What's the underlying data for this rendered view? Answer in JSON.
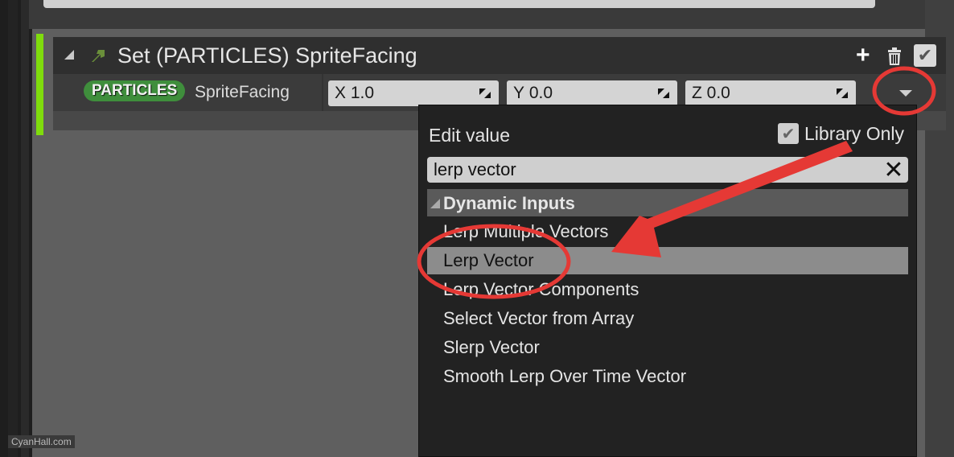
{
  "module": {
    "title": "Set (PARTICLES) SpriteFacing",
    "accent_color": "#7fdc0c",
    "header_icons": [
      "collapse-triangle-icon",
      "arrow-up-right-icon"
    ],
    "actions": {
      "add_icon": "plus-icon",
      "delete_icon": "trash-icon",
      "enabled_icon": "checkbox-checked-icon",
      "enabled": true
    }
  },
  "row": {
    "namespace_badge": "PARTICLES",
    "badge_color": "#3f8e3c",
    "param_name": "SpriteFacing",
    "fields": [
      {
        "axis": "X",
        "value": "1.0"
      },
      {
        "axis": "Y",
        "value": "0.0"
      },
      {
        "axis": "Z",
        "value": "0.0"
      }
    ],
    "dropdown_icon": "chevron-down-icon"
  },
  "popup": {
    "title": "Edit value",
    "library_only_label": "Library Only",
    "library_only_checked": true,
    "search_value": "lerp vector",
    "search_clear_icon": "close-icon",
    "category": "Dynamic Inputs",
    "items": [
      {
        "label": "Lerp Multiple Vectors",
        "selected": false
      },
      {
        "label": "Lerp Vector",
        "selected": true
      },
      {
        "label": "Lerp Vector Components",
        "selected": false
      },
      {
        "label": "Select Vector from Array",
        "selected": false
      },
      {
        "label": "Slerp Vector",
        "selected": false
      },
      {
        "label": "Smooth Lerp Over Time Vector",
        "selected": false
      }
    ]
  },
  "annotations": {
    "color": "#e53935",
    "circles": [
      "dropdown-button",
      "lerp-vector-item"
    ],
    "arrow": "library-only to lerp-vector-item"
  },
  "watermark": "CyanHall.com"
}
